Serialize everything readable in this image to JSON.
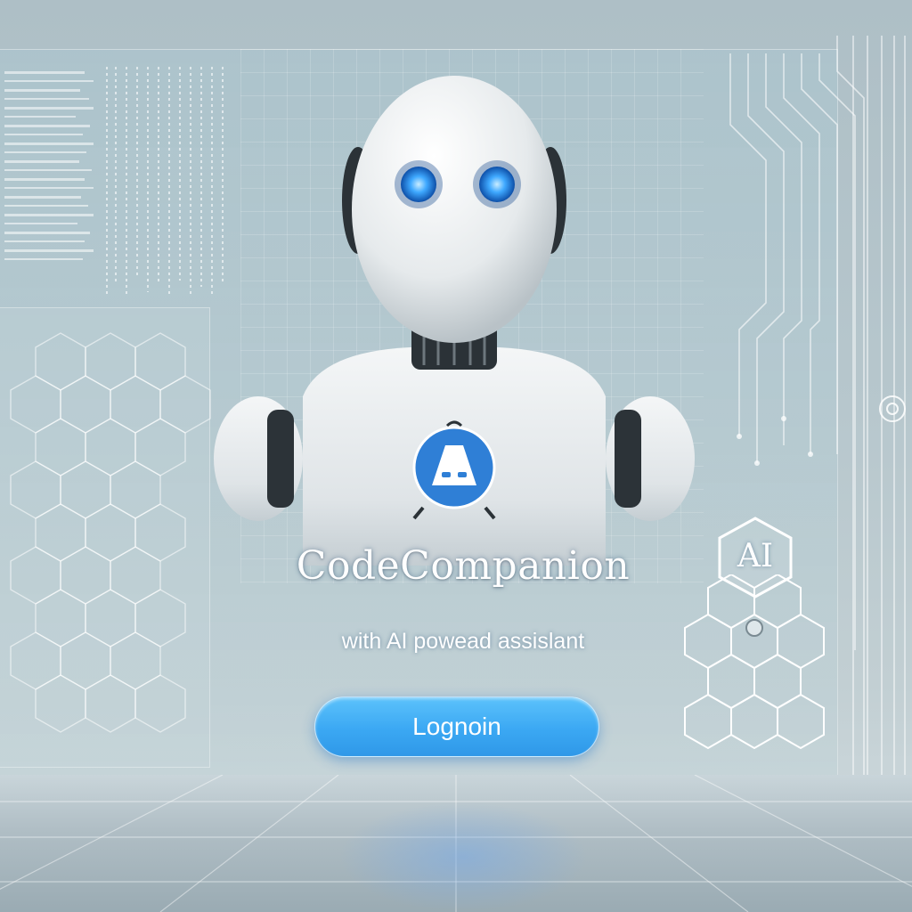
{
  "app": {
    "title": "CodeCompanion",
    "subtitle": "with AI powead  assislant"
  },
  "login": {
    "label": "Lognoin"
  },
  "badge": {
    "label": "AI"
  },
  "icons": {
    "mascot": "robot-mascot-icon",
    "chest_logo": "arch-logo-icon",
    "badge": "hexagon-icon",
    "target": "target-icon"
  },
  "colors": {
    "accent": "#3ba8f3",
    "eye_glow": "#3fa9ff",
    "logo_blue": "#2f7fd6",
    "robot_white": "#f2f4f5"
  }
}
